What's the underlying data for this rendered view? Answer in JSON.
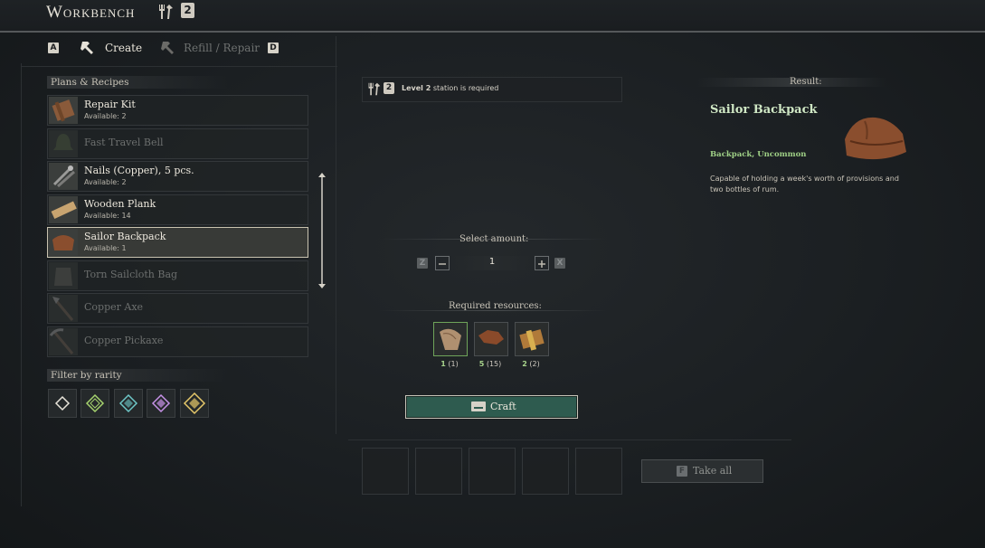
{
  "header": {
    "title": "Workbench",
    "level": "2"
  },
  "tabs": {
    "prev_key": "A",
    "create_label": "Create",
    "refill_label": "Refill / Repair",
    "next_key": "D"
  },
  "recipes_panel": {
    "label": "Plans & Recipes",
    "items": [
      {
        "name": "Repair Kit",
        "available": "Available: 2"
      },
      {
        "name": "Fast Travel Bell",
        "available": ""
      },
      {
        "name": "Nails (Copper), 5 pcs.",
        "available": "Available: 2"
      },
      {
        "name": "Wooden Plank",
        "available": "Available: 14"
      },
      {
        "name": "Sailor Backpack",
        "available": "Available: 1"
      },
      {
        "name": "Torn Sailcloth Bag",
        "available": ""
      },
      {
        "name": "Copper Axe",
        "available": ""
      },
      {
        "name": "Copper Pickaxe",
        "available": ""
      }
    ],
    "filter_label": "Filter by rarity"
  },
  "requirement": {
    "level_num": "2",
    "level_text": "Level 2",
    "suffix": "station is required"
  },
  "amount": {
    "label": "Select amount:",
    "value": "1",
    "dec_key": "Z",
    "inc_key": "X"
  },
  "resources": {
    "label": "Required resources:",
    "items": [
      {
        "have": "1",
        "total": "(1)"
      },
      {
        "have": "5",
        "total": "(15)"
      },
      {
        "have": "2",
        "total": "(2)"
      }
    ]
  },
  "craft_label": "Craft",
  "take_all": {
    "key": "F",
    "label": "Take all"
  },
  "result": {
    "label": "Result:",
    "name": "Sailor Backpack",
    "type": "Backpack, Uncommon",
    "description": "Capable of holding a week's worth of provisions and two bottles of rum."
  },
  "colors": {
    "accent_green": "#9fd086",
    "craft_button": "#2e5b4f",
    "result_name": "#cfe7c4"
  }
}
